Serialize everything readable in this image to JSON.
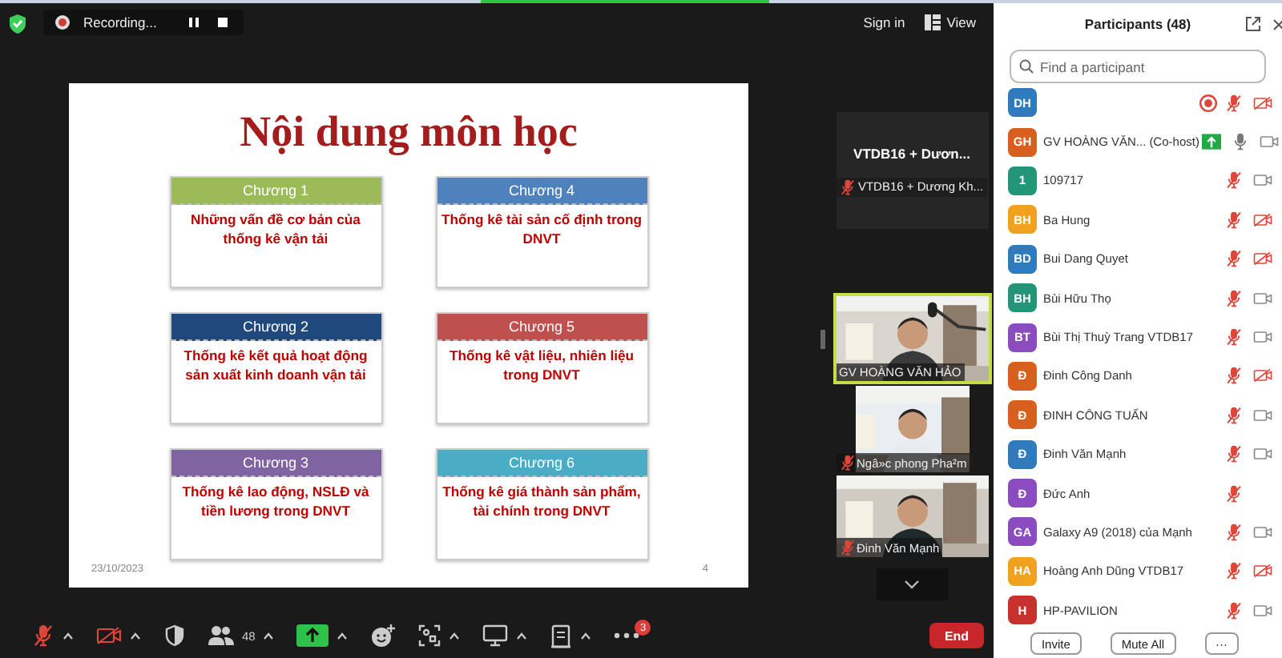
{
  "top_bar": {
    "recording": "Recording...",
    "sign_in": "Sign in",
    "view": "View"
  },
  "slide": {
    "title": "Nội dung môn học",
    "chapters": [
      {
        "heading": "Chương 1",
        "text": "Những vấn đề cơ bản của thống kê vận tải",
        "color": "#9bbb59"
      },
      {
        "heading": "Chương 2",
        "text": "Thống kê kết quả hoạt động sản xuất kinh doanh vận tải",
        "color": "#1f497d"
      },
      {
        "heading": "Chương 3",
        "text": "Thống kê lao động, NSLĐ và tiền lương trong DNVT",
        "color": "#8064a2"
      },
      {
        "heading": "Chương 4",
        "text": "Thống kê tài sản cố định trong DNVT",
        "color": "#4f81bd"
      },
      {
        "heading": "Chương 5",
        "text": "Thống kê vật liệu, nhiên liệu trong DNVT",
        "color": "#c0504d"
      },
      {
        "heading": "Chương 6",
        "text": "Thống kê giá thành sản phẩm, tài chính trong DNVT",
        "color": "#4bacc6"
      }
    ],
    "date": "23/10/2023",
    "page": "4"
  },
  "videos": [
    {
      "kind": "name",
      "title": "VTDB16 + Dươn...",
      "label": "VTDB16 + Dương Kh...",
      "muted": true,
      "active": false
    },
    {
      "kind": "camera",
      "label": "GV HOÀNG VĂN HẢO",
      "muted": false,
      "active": true
    },
    {
      "kind": "camera",
      "label": "Ngâ»c phong Pha²m",
      "muted": true,
      "active": false
    },
    {
      "kind": "camera",
      "label": "Đinh Văn Mạnh",
      "muted": true,
      "active": false
    }
  ],
  "participants": {
    "title": "Participants (48)",
    "search": {
      "placeholder": "Find a participant"
    },
    "people": [
      {
        "initials": "DH",
        "color": "#2f7bbd",
        "recording": true,
        "muted": true,
        "video_off": true
      },
      {
        "initials": "GH",
        "color": "#d8601e",
        "name": "GV HOÀNG VĂN...",
        "role": "(Co-host)",
        "sharing": true,
        "muted": false,
        "video_off": false
      },
      {
        "initials": "1",
        "color": "#23967a",
        "name": "109717",
        "muted": true,
        "video_off": false
      },
      {
        "initials": "BH",
        "color": "#f0a21e",
        "name": "Ba Hung",
        "muted": true,
        "video_off": true
      },
      {
        "initials": "BD",
        "color": "#2f7bbd",
        "name": "Bui Dang Quyet",
        "muted": true,
        "video_off": true
      },
      {
        "initials": "BH",
        "color": "#23967a",
        "name": "Bùi Hữu Thọ",
        "muted": true,
        "video_off": false
      },
      {
        "initials": "BT",
        "color": "#8a4cbf",
        "name": "Bùi Thị Thuỳ Trang VTDB17",
        "muted": true,
        "video_off": false
      },
      {
        "initials": "Đ",
        "color": "#d8601e",
        "name": "Đinh Công Danh",
        "muted": true,
        "video_off": true
      },
      {
        "initials": "Đ",
        "color": "#d8601e",
        "name": "ĐINH CÔNG TUẤN",
        "muted": true,
        "video_off": false
      },
      {
        "initials": "Đ",
        "color": "#2f7bbd",
        "name": "Đinh Văn Mạnh",
        "muted": true,
        "video_off": false
      },
      {
        "initials": "Đ",
        "color": "#8a4cbf",
        "name": "Đức Anh",
        "muted": true
      },
      {
        "initials": "GA",
        "color": "#8a4cbf",
        "name": "Galaxy A9 (2018) của Mạnh",
        "muted": true,
        "video_off": false
      },
      {
        "initials": "HA",
        "color": "#f0a21e",
        "name": "Hoàng Anh Dũng VTDB17",
        "muted": true,
        "video_off": true
      },
      {
        "initials": "H",
        "color": "#c8322e",
        "name": "HP-PAVILION",
        "muted": true,
        "video_off": false
      }
    ],
    "buttons": [
      "Invite",
      "Mute All",
      "···"
    ]
  },
  "toolbar": {
    "items": [
      {
        "kind": "mic",
        "muted": true,
        "caret": true
      },
      {
        "kind": "video",
        "muted": true,
        "caret": true
      },
      {
        "kind": "security",
        "caret": false
      },
      {
        "kind": "participants",
        "count": "48",
        "caret": true
      },
      {
        "kind": "share",
        "caret": true
      },
      {
        "kind": "reactions",
        "caret": false
      },
      {
        "kind": "apps",
        "caret": true
      },
      {
        "kind": "whiteboard",
        "caret": true
      },
      {
        "kind": "notes",
        "caret": true
      },
      {
        "kind": "more",
        "badge": "3",
        "caret": false
      }
    ],
    "end": "End"
  }
}
